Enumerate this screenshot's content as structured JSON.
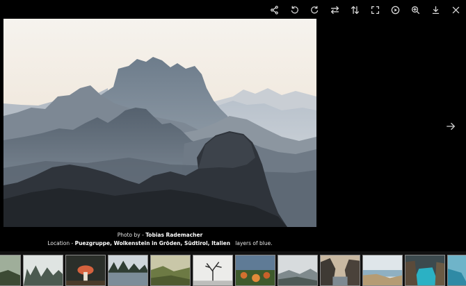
{
  "toolbar": {
    "icons": [
      "share-icon",
      "rotate-left-icon",
      "rotate-right-icon",
      "flip-horizontal-icon",
      "flip-vertical-icon",
      "fullscreen-icon",
      "play-icon",
      "zoom-in-icon",
      "download-icon",
      "close-icon"
    ]
  },
  "photo": {
    "subject": "mountain ridges in layered blue mist"
  },
  "caption": {
    "photo_by_label": "Photo by -",
    "photographer": "Tobias Rademacher",
    "location_label": "Location -",
    "location": "Puezgruppe, Wolkenstein in Gröden, Südtirol, Italien",
    "description": "layers of blue."
  },
  "navigation": {
    "next_icon": "arrow-right-icon"
  },
  "filmstrip": {
    "thumbnails": [
      "forest-edge",
      "misty-forest",
      "red-mushroom",
      "lake-trees",
      "green-valley",
      "bare-tree",
      "orange-flowers",
      "foggy-hills",
      "rocky-canyon",
      "coastal-dunes",
      "turquoise-cove",
      "ocean-coast"
    ]
  },
  "colors": {
    "background": "#000000",
    "filmstrip_background": "#111111",
    "icon_color": "#d8d8d8",
    "thumb_border": "#8a8a8a"
  }
}
